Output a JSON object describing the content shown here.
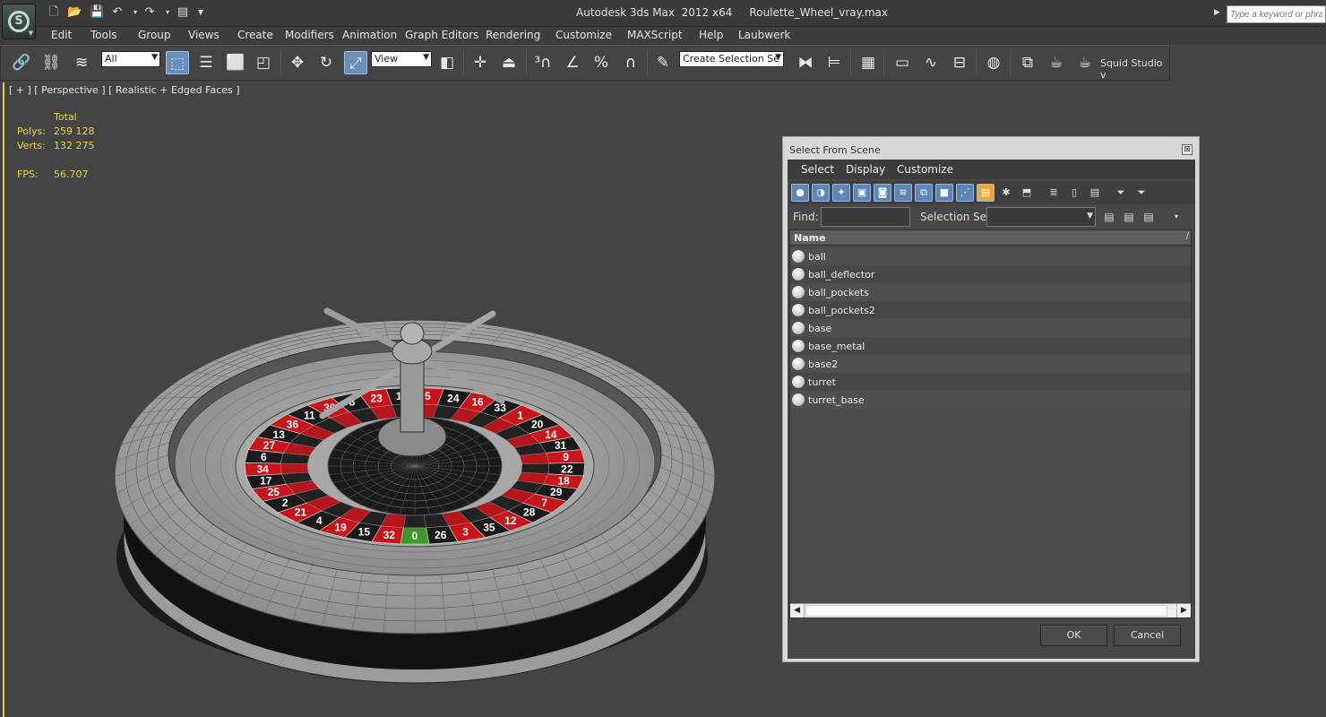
{
  "app": {
    "title": "Autodesk 3ds Max  2012 x64     Roulette_Wheel_vray.max",
    "search_placeholder": "Type a keyword or phrase"
  },
  "menu": [
    "Edit",
    "Tools",
    "Group",
    "Views",
    "Create",
    "Modifiers",
    "Animation",
    "Graph Editors",
    "Rendering",
    "Customize",
    "MAXScript",
    "Help",
    "Laubwerk"
  ],
  "toolbar": {
    "selection_filter": "All",
    "ref_coord": "View",
    "named_selection": "Create Selection Se",
    "squid_label": "Squid Studio v"
  },
  "viewport": {
    "label": "[ + ] [ Perspective ] [ Realistic + Edged Faces ]",
    "stats": {
      "total_label": "Total",
      "polys_label": "Polys:",
      "polys_value": "259 128",
      "verts_label": "Verts:",
      "verts_value": "132 275",
      "fps_label": "FPS:",
      "fps_value": "56.707"
    }
  },
  "dialog": {
    "title": "Select From Scene",
    "close_glyph": "⊠",
    "menus": [
      "Select",
      "Display",
      "Customize"
    ],
    "find_label": "Find:",
    "find_value": "",
    "selection_set_label": "Selection Set:",
    "column_name": "Name",
    "column_sort": "/",
    "objects": [
      "ball",
      "ball_deflector",
      "ball_pockets",
      "ball_pockets2",
      "base",
      "base_metal",
      "base2",
      "turret",
      "turret_base"
    ],
    "ok_label": "OK",
    "cancel_label": "Cancel"
  },
  "wheel": {
    "numbers": [
      "0",
      "32",
      "15",
      "19",
      "4",
      "21",
      "2",
      "25",
      "17",
      "34",
      "6",
      "27",
      "13",
      "36",
      "11",
      "30",
      "8",
      "23",
      "10",
      "5",
      "24",
      "16",
      "33",
      "1",
      "20",
      "14",
      "31",
      "9",
      "22",
      "18",
      "29",
      "7",
      "28",
      "12",
      "35",
      "3",
      "26"
    ],
    "colors": {
      "red": "#c8151b",
      "black": "#1a1a1a",
      "green": "#3a9a2a"
    }
  }
}
